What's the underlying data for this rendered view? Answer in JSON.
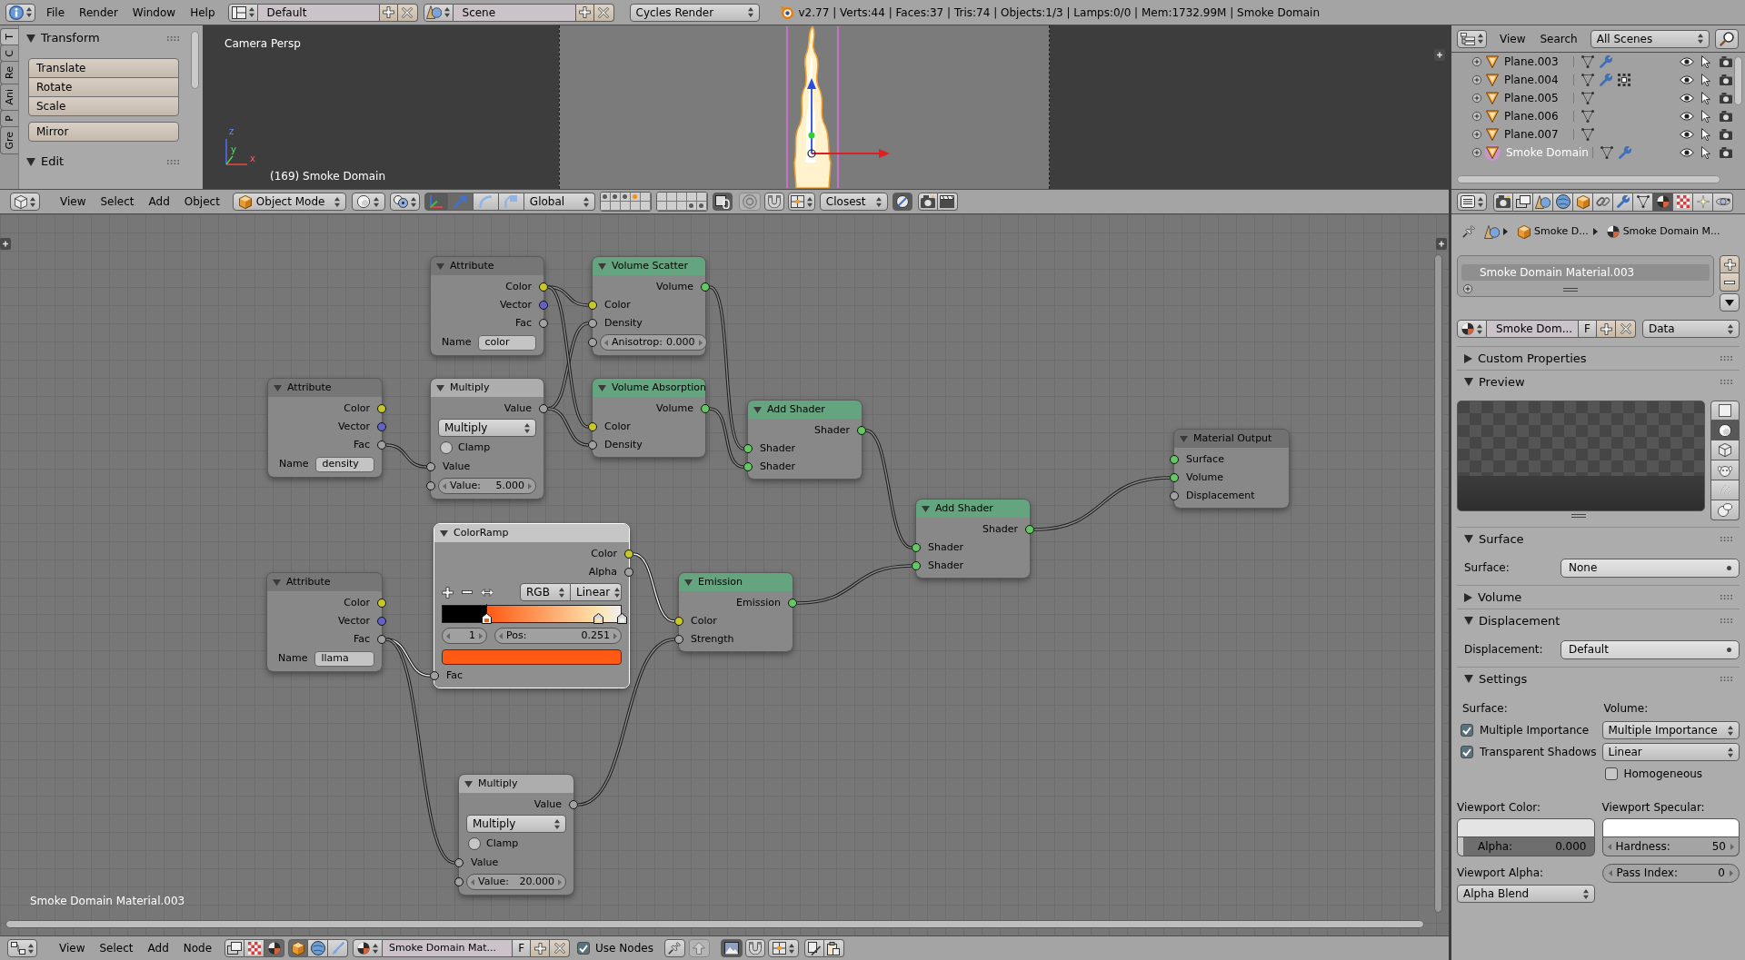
{
  "info_bar": {
    "menus": [
      "File",
      "Render",
      "Window",
      "Help"
    ],
    "screen_layout": "Default",
    "scene": "Scene",
    "render_engine": "Cycles Render",
    "stats": "v2.77 | Verts:44 | Faces:37 | Tris:74 | Objects:1/3 | Lamps:0/0 | Mem:1732.99M | Smoke Domain"
  },
  "tool_shelf": {
    "tabs": [
      {
        "label": "T",
        "selected": true
      },
      {
        "label": "C",
        "selected": false
      },
      {
        "label": "Re",
        "selected": false
      },
      {
        "label": "Ani",
        "selected": false
      },
      {
        "label": "P",
        "selected": false
      },
      {
        "label": "Gre",
        "selected": false
      }
    ],
    "panels": [
      {
        "title": "Transform",
        "expanded": true,
        "groups": [
          [
            "Translate",
            "Rotate",
            "Scale"
          ],
          [
            "Mirror"
          ]
        ]
      },
      {
        "title": "Edit",
        "expanded": true
      }
    ]
  },
  "viewport": {
    "view_name": "Camera Persp",
    "object_label": "(169) Smoke Domain",
    "axis_labels": [
      "z",
      "y",
      "x"
    ]
  },
  "viewport_header": {
    "menus": [
      "View",
      "Select",
      "Add",
      "Object"
    ],
    "mode": "Object Mode",
    "manipulator_toggle": {
      "on": true
    },
    "manipulators": [
      {
        "kind": "translate",
        "selected": true
      },
      {
        "kind": "rotate",
        "selected": false
      },
      {
        "kind": "scale",
        "selected": false
      }
    ],
    "orientation": "Global",
    "layers": [
      {
        "selected": false,
        "objects": true,
        "active_object": false
      },
      {
        "selected": false,
        "objects": true,
        "active_object": false
      },
      {
        "selected": false,
        "objects": true,
        "active_object": false
      },
      {
        "selected": false,
        "active_object": true
      },
      {
        "selected": false,
        "objects": false,
        "active_object": false
      },
      {
        "selected": false,
        "objects": false,
        "active_object": false
      },
      {
        "selected": false,
        "objects": false,
        "active_object": false
      },
      {
        "selected": false,
        "objects": false,
        "active_object": false
      },
      {
        "selected": false,
        "objects": false,
        "active_object": false
      },
      {
        "selected": false,
        "objects": false,
        "active_object": false
      },
      {
        "selected": false,
        "objects": false,
        "active_object": false
      },
      {
        "selected": false,
        "objects": false,
        "active_object": false
      },
      {
        "selected": false,
        "objects": false,
        "active_object": false
      },
      {
        "selected": false,
        "objects": false,
        "active_object": false
      },
      {
        "selected": false,
        "objects": false,
        "active_object": false
      },
      {
        "selected": false,
        "objects": false,
        "active_object": false
      },
      {
        "selected": false,
        "objects": false,
        "active_object": false
      },
      {
        "selected": false,
        "objects": false,
        "active_object": false
      },
      {
        "selected": false,
        "objects": true,
        "active_object": false
      },
      {
        "selected": false,
        "objects": true,
        "active_object": false
      }
    ],
    "scene_lock": {
      "on": true
    },
    "snap": {
      "on": false
    },
    "snap_target": "Closest",
    "align_rotation": {
      "on": true
    }
  },
  "outliner": {
    "menus": [
      "View",
      "Search"
    ],
    "filter": "All Scenes",
    "rows": [
      {
        "name": "Plane.003",
        "selected": false,
        "modifier": true,
        "particles": false
      },
      {
        "name": "Plane.004",
        "selected": false,
        "modifier": true,
        "particles": true
      },
      {
        "name": "Plane.005",
        "selected": false,
        "modifier": false,
        "particles": false
      },
      {
        "name": "Plane.006",
        "selected": false,
        "modifier": false,
        "particles": false
      },
      {
        "name": "Plane.007",
        "selected": false,
        "modifier": false,
        "particles": false
      },
      {
        "name": "Smoke Domain",
        "selected": true,
        "modifier": true,
        "particles": false
      }
    ]
  },
  "properties_header": {
    "tabs": [
      {
        "kind": "render",
        "selected": false
      },
      {
        "kind": "render_layers",
        "selected": false
      },
      {
        "kind": "scene",
        "selected": false
      },
      {
        "kind": "world",
        "selected": false
      },
      {
        "kind": "object",
        "selected": false
      },
      {
        "kind": "constraints",
        "selected": false
      },
      {
        "kind": "modifiers",
        "selected": false
      },
      {
        "kind": "data",
        "selected": false
      },
      {
        "kind": "material",
        "selected": true
      },
      {
        "kind": "texture",
        "selected": false
      },
      {
        "kind": "particles",
        "selected": false
      },
      {
        "kind": "physics",
        "selected": false
      }
    ]
  },
  "properties": {
    "breadcrumb": [
      "Smoke D...",
      "Smoke Domain M..."
    ],
    "slots": [
      {
        "name": "Smoke Domain Material.003",
        "selected": true
      }
    ],
    "material": {
      "name": "Smoke Dom...",
      "fake_user": "F",
      "link": "Data"
    },
    "panels": [
      {
        "kind": "plain",
        "title": "Custom Properties",
        "expanded": false
      },
      {
        "kind": "preview",
        "title": "Preview",
        "expanded": true,
        "shapes": [
          {
            "kind": "plane",
            "selected": false
          },
          {
            "kind": "sphere",
            "selected": true
          },
          {
            "kind": "cube",
            "selected": false
          },
          {
            "kind": "monkey",
            "selected": false
          },
          {
            "kind": "hair",
            "selected": false
          },
          {
            "kind": "sky",
            "selected": false
          }
        ]
      },
      {
        "kind": "field",
        "title": "Surface",
        "expanded": true,
        "label": "Surface:",
        "value": "None"
      },
      {
        "kind": "plain",
        "title": "Volume",
        "expanded": false
      },
      {
        "kind": "field",
        "title": "Displacement",
        "expanded": true,
        "label": "Displacement:",
        "value": "Default"
      },
      {
        "kind": "settings",
        "title": "Settings",
        "expanded": true,
        "surface_label": "Surface:",
        "volume_label": "Volume:",
        "checkboxes": [
          {
            "label": "Multiple Importance",
            "checked": true
          },
          {
            "label": "Transparent Shadows",
            "checked": true
          }
        ],
        "volume_options": [
          "Multiple Importance",
          "Linear"
        ],
        "homogeneous": {
          "label": "Homogeneous",
          "checked": false
        },
        "viewport_color": {
          "label": "Viewport Color:",
          "color": "#e4e4e4",
          "alpha_label": "Alpha:",
          "alpha_value": "0.000",
          "level": 0
        },
        "viewport_specular": {
          "label": "Viewport Specular:",
          "color": "#ffffff",
          "hardness_label": "Hardness:",
          "hardness_value": "50"
        },
        "viewport_alpha": {
          "label": "Viewport Alpha:",
          "value": "Alpha Blend"
        },
        "pass_index": {
          "label": "Pass Index:",
          "value": "0"
        }
      }
    ]
  },
  "node_editor": {
    "material_label": "Smoke Domain Material.003",
    "nodes": [
      {
        "title": "Attribute",
        "kind": "input",
        "selected": false,
        "rows": [
          {
            "kind": "output",
            "label": "Color",
            "color": "#c7c729"
          },
          {
            "kind": "output",
            "label": "Vector",
            "color": "#6363c7"
          },
          {
            "kind": "output",
            "label": "Fac",
            "color": "#a1a1a1"
          },
          {
            "kind": "text",
            "label": "Name",
            "value": "color"
          }
        ]
      },
      {
        "title": "Volume Scatter",
        "kind": "shader",
        "selected": false,
        "rows": [
          {
            "kind": "output",
            "label": "Volume",
            "color": "#63c763"
          },
          {
            "kind": "input",
            "label": "Color",
            "color": "#c7c729",
            "linked": true
          },
          {
            "kind": "input",
            "label": "Density",
            "color": "#a1a1a1",
            "linked": true
          },
          {
            "kind": "number",
            "label": "Anisotrop:",
            "value": "0.000",
            "color": "#a1a1a1"
          }
        ]
      },
      {
        "title": "Attribute",
        "kind": "input",
        "selected": false,
        "rows": [
          {
            "kind": "output",
            "label": "Color",
            "color": "#c7c729"
          },
          {
            "kind": "output",
            "label": "Vector",
            "color": "#6363c7"
          },
          {
            "kind": "output",
            "label": "Fac",
            "color": "#a1a1a1"
          },
          {
            "kind": "text",
            "label": "Name",
            "value": "density"
          }
        ]
      },
      {
        "title": "Multiply",
        "kind": "converter",
        "selected": false,
        "rows": [
          {
            "kind": "output",
            "label": "Value",
            "color": "#a1a1a1"
          },
          {
            "kind": "dropdown",
            "value": "Multiply"
          },
          {
            "kind": "checkbox",
            "label": "Clamp",
            "checked": false
          },
          {
            "kind": "input",
            "label": "Value",
            "color": "#a1a1a1",
            "linked": true
          },
          {
            "kind": "number",
            "label": "Value:",
            "value": "5.000",
            "color": "#a1a1a1"
          }
        ]
      },
      {
        "title": "Volume Absorption",
        "kind": "shader",
        "selected": false,
        "rows": [
          {
            "kind": "output",
            "label": "Volume",
            "color": "#63c763"
          },
          {
            "kind": "input",
            "label": "Color",
            "color": "#c7c729",
            "linked": true
          },
          {
            "kind": "input",
            "label": "Density",
            "color": "#a1a1a1",
            "linked": true
          }
        ]
      },
      {
        "title": "Add Shader",
        "kind": "shader",
        "selected": false,
        "rows": [
          {
            "kind": "output",
            "label": "Shader",
            "color": "#63c763"
          },
          {
            "kind": "input",
            "label": "Shader",
            "color": "#63c763",
            "linked": true
          },
          {
            "kind": "input",
            "label": "Shader",
            "color": "#63c763",
            "linked": true
          }
        ]
      },
      {
        "title": "Material Output",
        "kind": "output",
        "selected": false,
        "rows": [
          {
            "kind": "input",
            "label": "Surface",
            "color": "#63c763"
          },
          {
            "kind": "input",
            "label": "Volume",
            "color": "#63c763",
            "linked": true
          },
          {
            "kind": "input",
            "label": "Displacement",
            "color": "#a1a1a1"
          }
        ]
      },
      {
        "title": "Add Shader",
        "kind": "shader",
        "selected": false,
        "rows": [
          {
            "kind": "output",
            "label": "Shader",
            "color": "#63c763"
          },
          {
            "kind": "input",
            "label": "Shader",
            "color": "#63c763",
            "linked": true
          },
          {
            "kind": "input",
            "label": "Shader",
            "color": "#63c763",
            "linked": true
          }
        ]
      },
      {
        "title": "ColorRamp",
        "kind": "converter",
        "selected": true,
        "rows": [
          {
            "kind": "output",
            "label": "Color",
            "color": "#c7c729"
          },
          {
            "kind": "output",
            "label": "Alpha",
            "color": "#a1a1a1"
          },
          {
            "kind": "ramp_tools",
            "color_mode": "RGB",
            "interpolation": "Linear"
          },
          {
            "kind": "ramp",
            "stops": [
              {
                "level": 0.251,
                "color": "#ff5a14",
                "selected": true
              },
              {
                "level": 0.87,
                "color": "#fde3ad",
                "selected": false
              },
              {
                "level": 1,
                "color": "#efefef",
                "selected": false
              }
            ]
          },
          {
            "kind": "ramp_fields",
            "index": "1",
            "label": "Pos:",
            "value": "0.251"
          },
          {
            "kind": "swatch"
          },
          {
            "kind": "input",
            "label": "Fac",
            "color": "#a1a1a1",
            "linked": true
          }
        ]
      },
      {
        "title": "Attribute",
        "kind": "input",
        "selected": false,
        "rows": [
          {
            "kind": "output",
            "label": "Color",
            "color": "#c7c729"
          },
          {
            "kind": "output",
            "label": "Vector",
            "color": "#6363c7"
          },
          {
            "kind": "output",
            "label": "Fac",
            "color": "#a1a1a1"
          },
          {
            "kind": "text",
            "label": "Name",
            "value": "llama"
          }
        ]
      },
      {
        "title": "Emission",
        "kind": "shader",
        "selected": false,
        "rows": [
          {
            "kind": "output",
            "label": "Emission",
            "color": "#63c763"
          },
          {
            "kind": "input",
            "label": "Color",
            "color": "#c7c729",
            "linked": true
          },
          {
            "kind": "input",
            "label": "Strength",
            "color": "#a1a1a1",
            "linked": true
          }
        ]
      },
      {
        "title": "Multiply",
        "kind": "converter",
        "selected": false,
        "rows": [
          {
            "kind": "output",
            "label": "Value",
            "color": "#a1a1a1"
          },
          {
            "kind": "dropdown",
            "value": "Multiply"
          },
          {
            "kind": "checkbox",
            "label": "Clamp",
            "checked": false
          },
          {
            "kind": "input",
            "label": "Value",
            "color": "#a1a1a1",
            "linked": true
          },
          {
            "kind": "number",
            "label": "Value:",
            "value": "20.000",
            "color": "#a1a1a1"
          }
        ]
      }
    ]
  },
  "node_header": {
    "menus": [
      "View",
      "Select",
      "Add",
      "Node"
    ],
    "tree_types": [
      {
        "kind": "compositing",
        "selected": false
      },
      {
        "kind": "texture",
        "selected": false
      },
      {
        "kind": "shader",
        "selected": true
      }
    ],
    "shader_types": [
      {
        "kind": "object",
        "selected": true
      },
      {
        "kind": "world",
        "selected": false
      },
      {
        "kind": "line_style",
        "selected": false
      }
    ],
    "material": "Smoke Domain Mat...",
    "fake_user": "F",
    "use_nodes": {
      "label": "Use Nodes",
      "checked": true
    },
    "backdrop": {
      "on": true
    }
  }
}
